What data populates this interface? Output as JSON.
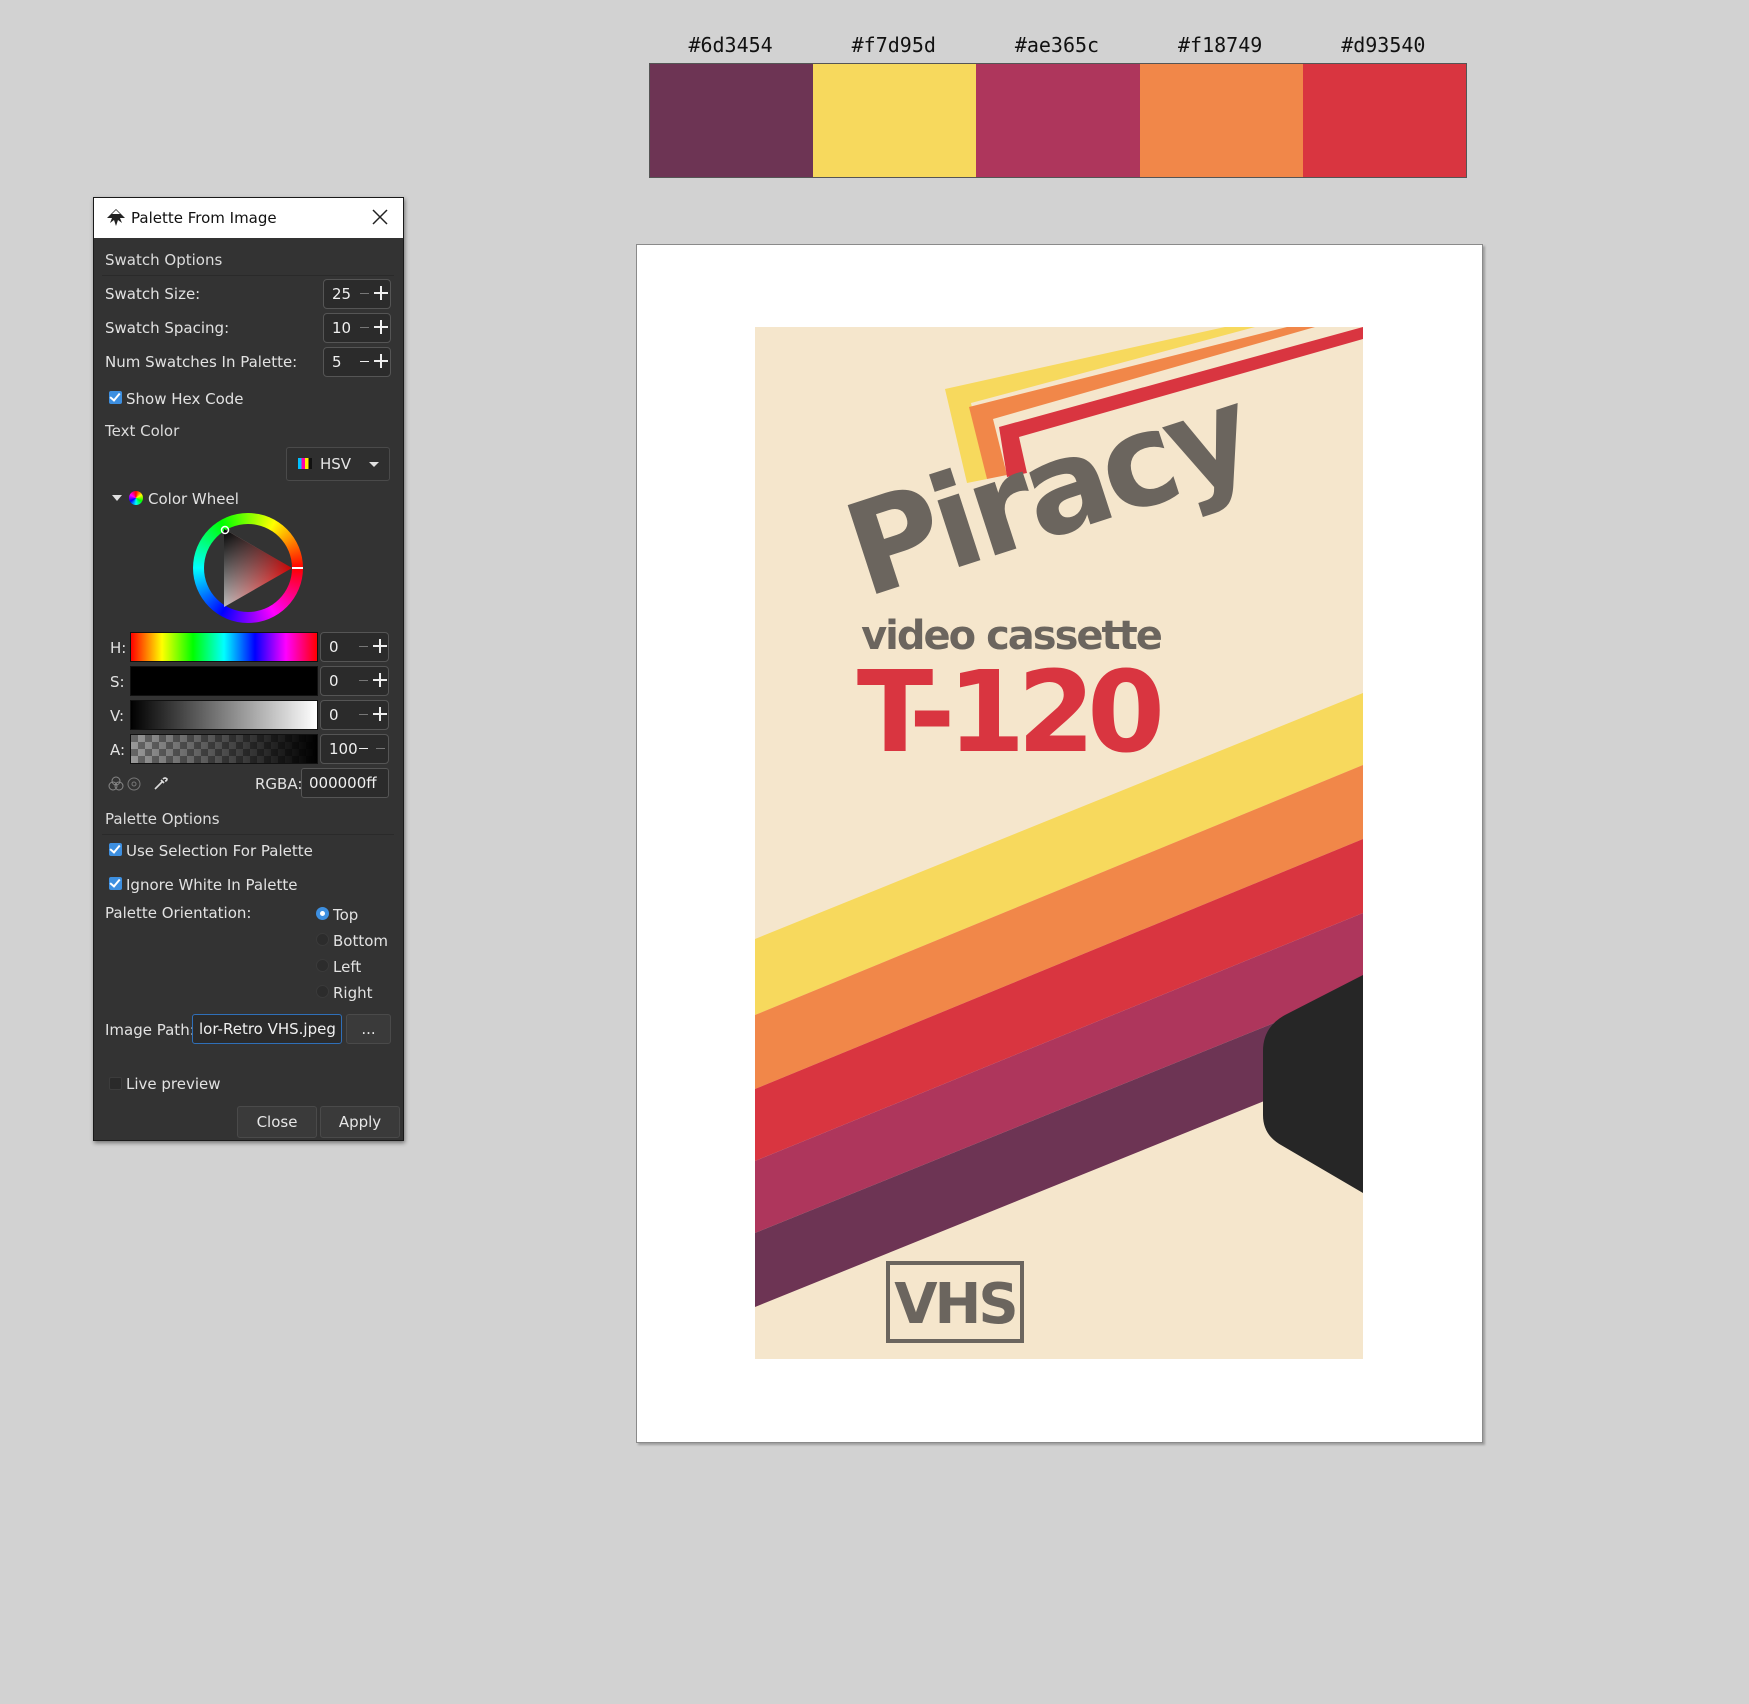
{
  "palette": {
    "swatches": [
      {
        "hex": "#6d3454",
        "color": "#6d3454"
      },
      {
        "hex": "#f7d95d",
        "color": "#f7d95d"
      },
      {
        "hex": "#ae365c",
        "color": "#ae365c"
      },
      {
        "hex": "#f18749",
        "color": "#f18749"
      },
      {
        "hex": "#d93540",
        "color": "#d93540"
      }
    ]
  },
  "artwork": {
    "brand": "Piracy",
    "subtitle": "video cassette",
    "model": "T-120",
    "format": "VHS",
    "colors": {
      "background": "#f5e6cc",
      "yellow": "#f7d95d",
      "orange": "#f18749",
      "red": "#d93540",
      "magenta": "#ae365c",
      "plum": "#6d3454",
      "text_gray": "#6b655e",
      "tape_black": "#262626"
    }
  },
  "dialog": {
    "title": "Palette From Image",
    "swatch_options": {
      "heading": "Swatch Options",
      "size": {
        "label": "Swatch Size:",
        "value": "25"
      },
      "spacing": {
        "label": "Swatch Spacing:",
        "value": "10"
      },
      "num": {
        "label": "Num Swatches In Palette:",
        "value": "5"
      },
      "show_hex": {
        "label": "Show Hex Code",
        "checked": true
      }
    },
    "text_color": {
      "heading": "Text Color",
      "mode": "HSV",
      "wheel_label": "Color Wheel",
      "h": {
        "label": "H:",
        "value": "0"
      },
      "s": {
        "label": "S:",
        "value": "0"
      },
      "v": {
        "label": "V:",
        "value": "0"
      },
      "a": {
        "label": "A:",
        "value": "100"
      },
      "rgba_label": "RGBA:",
      "rgba_value": "000000ff"
    },
    "palette_options": {
      "heading": "Palette Options",
      "use_selection": {
        "label": "Use Selection For Palette",
        "checked": true
      },
      "ignore_white": {
        "label": "Ignore White In Palette",
        "checked": true
      },
      "orientation_label": "Palette Orientation:",
      "orientations": [
        "Top",
        "Bottom",
        "Left",
        "Right"
      ],
      "selected_orientation": "Top"
    },
    "image_path": {
      "label": "Image Path:",
      "value": "lor-Retro VHS.jpeg",
      "browse": "..."
    },
    "live_preview": {
      "label": "Live preview",
      "checked": false
    },
    "buttons": {
      "close": "Close",
      "apply": "Apply"
    }
  }
}
